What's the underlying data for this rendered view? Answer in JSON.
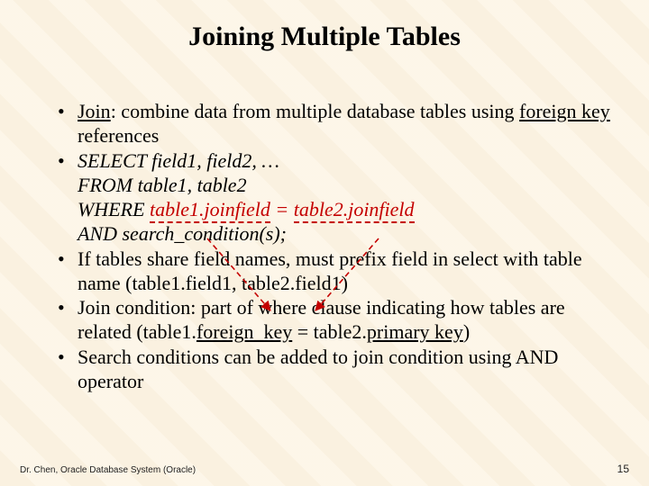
{
  "title": "Joining Multiple Tables",
  "bullets": {
    "b1": {
      "join_label": "Join",
      "after_join": ": combine data from multiple database tables using ",
      "fk": "foreign key",
      "after_fk": " references"
    },
    "b2": {
      "l1a": "SELECT",
      "l1b": " field1, field2, …",
      "l2a": "FROM",
      "l2b": " table1, table2",
      "l3a": "WHERE ",
      "l3_t1": "table1.joinfield",
      "l3_eq": " = ",
      "l3_t2": "table2.joinfield",
      "l4a": "AND",
      "l4b": " search_condition(s);"
    },
    "b3": {
      "text": "If tables share field names, must prefix field in select with table name (table1.field1, table2.field1)"
    },
    "b4": {
      "pre": "Join condition: part of where clause indicating how tables are related (table1.",
      "fk": "foreign_key",
      "mid": " = table2.",
      "pk": "primary key",
      "post": ")"
    },
    "b5": {
      "text": "Search conditions can be added to join condition using AND operator"
    }
  },
  "footer": {
    "left": "Dr. Chen, Oracle Database System (Oracle)",
    "right": "15"
  }
}
